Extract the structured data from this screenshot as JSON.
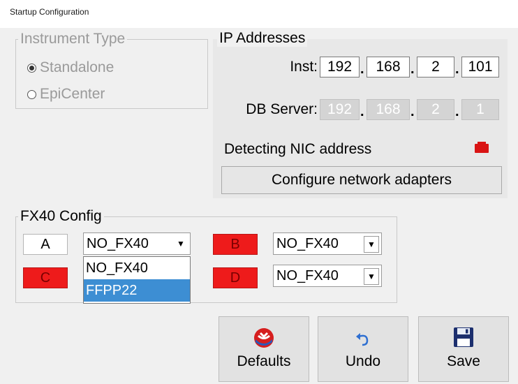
{
  "window": {
    "title": "Startup Configuration"
  },
  "instrument_type": {
    "legend": "Instrument Type",
    "options": [
      {
        "label": "Standalone",
        "selected": true
      },
      {
        "label": "EpiCenter",
        "selected": false
      }
    ]
  },
  "ip": {
    "legend": "IP Addresses",
    "inst_label": "Inst:",
    "inst": [
      "192",
      "168",
      "2",
      "101"
    ],
    "db_label": "DB Server:",
    "db": [
      "192",
      "168",
      "2",
      "1"
    ],
    "dot": ".",
    "nic_status": "Detecting NIC address",
    "nic_indicator_color": "#d91414",
    "configure_button": "Configure network adapters"
  },
  "fx40": {
    "legend": "FX40 Config",
    "units": [
      {
        "label": "A",
        "color": "white",
        "value": "NO_FX40"
      },
      {
        "label": "B",
        "color": "red",
        "value": "NO_FX40"
      },
      {
        "label": "C",
        "color": "red",
        "value": ""
      },
      {
        "label": "D",
        "color": "red",
        "value": "NO_FX40"
      }
    ],
    "open_dropdown": {
      "options": [
        "NO_FX40",
        "FFPP22"
      ],
      "highlighted": "FFPP22"
    }
  },
  "actions": {
    "defaults": "Defaults",
    "undo": "Undo",
    "save": "Save"
  },
  "colors": {
    "accent_red": "#ee1b1b",
    "highlight_blue": "#3d8ed3"
  }
}
